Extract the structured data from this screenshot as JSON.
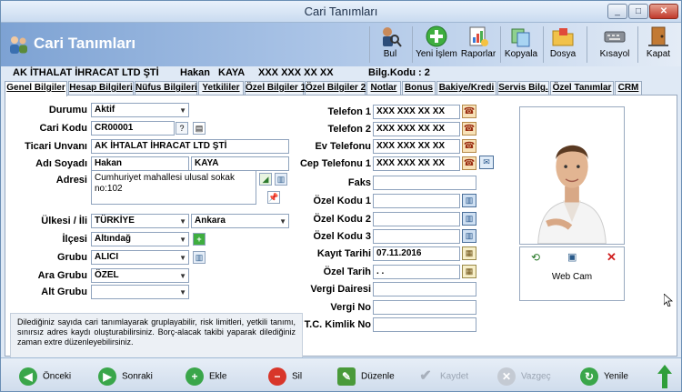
{
  "window": {
    "title": "Cari Tanımları",
    "min": "_",
    "max": "□",
    "close": "✕"
  },
  "header": {
    "title": "Cari Tanımları"
  },
  "toolbar": {
    "bul": "Bul",
    "yeni": "Yeni İşlem",
    "raporlar": "Raporlar",
    "kopyala": "Kopyala",
    "dosya": "Dosya",
    "kisayol": "Kısayol",
    "kapat": "Kapat"
  },
  "info": {
    "company": "AK İTHALAT İHRACAT LTD ŞTİ",
    "first": "Hakan",
    "last": "KAYA",
    "phone": "XXX XXX XX XX",
    "bilg": "Bilg.Kodu : 2"
  },
  "tabs": [
    "Genel Bilgiler",
    "Hesap Bilgileri",
    "Nüfus Bilgileri",
    "Yetkililer",
    "Özel Bilgiler 1",
    "Özel Bilgiler 2",
    "Notlar",
    "Bonus",
    "Bakiye/Kredi",
    "Servis Bilg.",
    "Özel Tanımlar",
    "CRM"
  ],
  "left": {
    "durum": {
      "label": "Durumu",
      "value": "Aktif"
    },
    "carikodu": {
      "label": "Cari Kodu",
      "value": "CR00001",
      "q": "?"
    },
    "unvan": {
      "label": "Ticari Unvanı",
      "value": "AK İHTALAT İHRACAT LTD ŞTİ"
    },
    "adsoyad": {
      "label": "Adı Soyadı",
      "first": "Hakan",
      "last": "KAYA"
    },
    "adres": {
      "label": "Adresi",
      "value": "Cumhuriyet mahallesi ulusal sokak no:102"
    },
    "ulke": {
      "label": "Ülkesi / İli",
      "country": "TÜRKİYE",
      "city": "Ankara"
    },
    "ilce": {
      "label": "İlçesi",
      "value": "Altındağ"
    },
    "grubu": {
      "label": "Grubu",
      "value": "ALICI"
    },
    "aragrubu": {
      "label": "Ara Grubu",
      "value": "ÖZEL"
    },
    "altgrubu": {
      "label": "Alt Grubu",
      "value": ""
    }
  },
  "right": {
    "tel1": {
      "label": "Telefon 1",
      "value": "XXX XXX XX XX"
    },
    "tel2": {
      "label": "Telefon 2",
      "value": "XXX XXX XX XX"
    },
    "evtel": {
      "label": "Ev Telefonu",
      "value": "XXX XXX XX XX"
    },
    "cep": {
      "label": "Cep Telefonu 1",
      "value": "XXX XXX XX XX"
    },
    "faks": {
      "label": "Faks",
      "value": ""
    },
    "ozel1": {
      "label": "Özel Kodu 1",
      "value": ""
    },
    "ozel2": {
      "label": "Özel Kodu 2",
      "value": ""
    },
    "ozel3": {
      "label": "Özel Kodu 3",
      "value": ""
    },
    "kayit": {
      "label": "Kayıt Tarihi",
      "value": "07.11.2016"
    },
    "ozeltarih": {
      "label": "Özel Tarih",
      "value": " . ."
    },
    "vergidaire": {
      "label": "Vergi Dairesi",
      "value": ""
    },
    "vergino": {
      "label": "Vergi No",
      "value": ""
    },
    "tckimlik": {
      "label": "T.C. Kimlik No",
      "value": ""
    }
  },
  "webcam": {
    "label": "Web Cam"
  },
  "note": "Dilediğiniz sayıda cari tanımlayarak gruplayabilir, risk limitleri, yetkili tanımı, sınırsız adres kaydı oluşturabilirsiniz. Borç-alacak takibi yaparak dilediğiniz zaman extre düzenleyebilirsiniz.",
  "bottom": {
    "onceki": "Önceki",
    "sonraki": "Sonraki",
    "ekle": "Ekle",
    "sil": "Sil",
    "duzenle": "Düzenle",
    "kaydet": "Kaydet",
    "vazgec": "Vazgeç",
    "yenile": "Yenile"
  }
}
